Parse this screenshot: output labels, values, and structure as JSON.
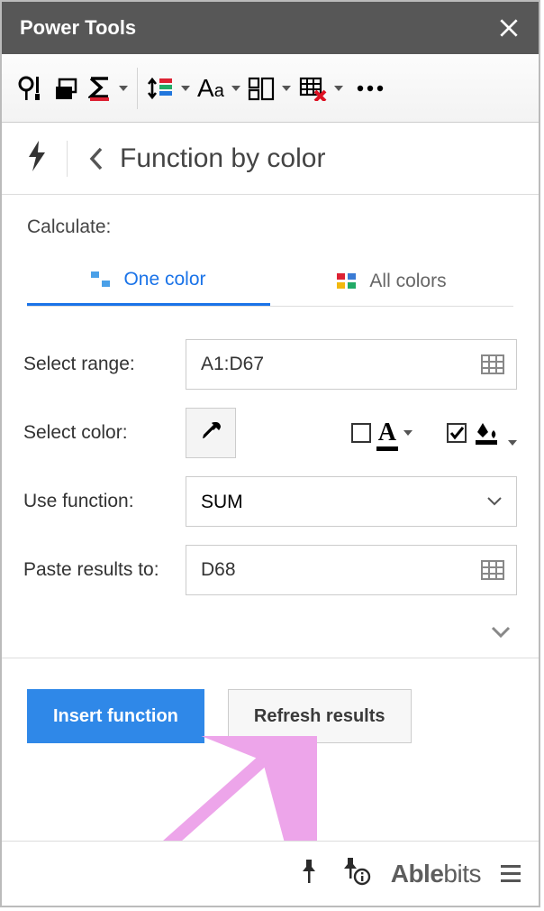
{
  "header": {
    "title": "Power Tools"
  },
  "page": {
    "title": "Function by color"
  },
  "calculate_label": "Calculate:",
  "tabs": {
    "one": "One color",
    "all": "All colors"
  },
  "form": {
    "select_range_label": "Select range:",
    "select_range_value": "A1:D67",
    "select_color_label": "Select color:",
    "use_function_label": "Use function:",
    "use_function_value": "SUM",
    "paste_results_label": "Paste results to:",
    "paste_results_value": "D68"
  },
  "buttons": {
    "insert": "Insert function",
    "refresh": "Refresh results"
  },
  "brand": {
    "name": "Ablebits"
  }
}
